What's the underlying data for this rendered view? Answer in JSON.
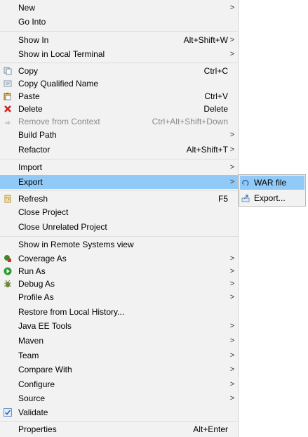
{
  "menu": {
    "items": [
      {
        "label": "New",
        "shortcut": "",
        "submenu": true
      },
      {
        "label": "Go Into",
        "shortcut": "",
        "submenu": false
      },
      {
        "label": "Show In",
        "shortcut": "Alt+Shift+W",
        "submenu": true
      },
      {
        "label": "Show in Local Terminal",
        "shortcut": "",
        "submenu": true
      },
      {
        "label": "Copy",
        "shortcut": "Ctrl+C",
        "submenu": false,
        "icon": "copy-icon"
      },
      {
        "label": "Copy Qualified Name",
        "shortcut": "",
        "submenu": false,
        "icon": "copy-qualified-name-icon"
      },
      {
        "label": "Paste",
        "shortcut": "Ctrl+V",
        "submenu": false,
        "icon": "paste-icon"
      },
      {
        "label": "Delete",
        "shortcut": "Delete",
        "submenu": false,
        "icon": "delete-icon"
      },
      {
        "label": "Remove from Context",
        "shortcut": "Ctrl+Alt+Shift+Down",
        "submenu": false,
        "disabled": true,
        "icon": "remove-context-icon"
      },
      {
        "label": "Build Path",
        "shortcut": "",
        "submenu": true
      },
      {
        "label": "Refactor",
        "shortcut": "Alt+Shift+T",
        "submenu": true
      },
      {
        "label": "Import",
        "shortcut": "",
        "submenu": true
      },
      {
        "label": "Export",
        "shortcut": "",
        "submenu": true,
        "highlighted": true
      },
      {
        "label": "Refresh",
        "shortcut": "F5",
        "submenu": false,
        "icon": "refresh-icon"
      },
      {
        "label": "Close Project",
        "shortcut": "",
        "submenu": false
      },
      {
        "label": "Close Unrelated Project",
        "shortcut": "",
        "submenu": false
      },
      {
        "label": "Show in Remote Systems view",
        "shortcut": "",
        "submenu": false
      },
      {
        "label": "Coverage As",
        "shortcut": "",
        "submenu": true,
        "icon": "coverage-icon"
      },
      {
        "label": "Run As",
        "shortcut": "",
        "submenu": true,
        "icon": "run-icon"
      },
      {
        "label": "Debug As",
        "shortcut": "",
        "submenu": true,
        "icon": "debug-icon"
      },
      {
        "label": "Profile As",
        "shortcut": "",
        "submenu": true
      },
      {
        "label": "Restore from Local History...",
        "shortcut": "",
        "submenu": false
      },
      {
        "label": "Java EE Tools",
        "shortcut": "",
        "submenu": true
      },
      {
        "label": "Maven",
        "shortcut": "",
        "submenu": true
      },
      {
        "label": "Team",
        "shortcut": "",
        "submenu": true
      },
      {
        "label": "Compare With",
        "shortcut": "",
        "submenu": true
      },
      {
        "label": "Configure",
        "shortcut": "",
        "submenu": true
      },
      {
        "label": "Source",
        "shortcut": "",
        "submenu": true
      },
      {
        "label": "Validate",
        "shortcut": "",
        "submenu": false,
        "icon": "validate-check-icon"
      },
      {
        "label": "Properties",
        "shortcut": "Alt+Enter",
        "submenu": false
      }
    ],
    "arrow_glyph": ">"
  },
  "export_submenu": {
    "items": [
      {
        "label": "WAR file",
        "icon": "war-file-icon",
        "highlighted": true
      },
      {
        "label": "Export...",
        "icon": "export-wizard-icon",
        "highlighted": false
      }
    ]
  },
  "colors": {
    "menu_bg": "#f2f2f2",
    "highlight": "#91c9f7",
    "disabled_text": "#8a8a8a",
    "separator": "#dcdcdc"
  }
}
